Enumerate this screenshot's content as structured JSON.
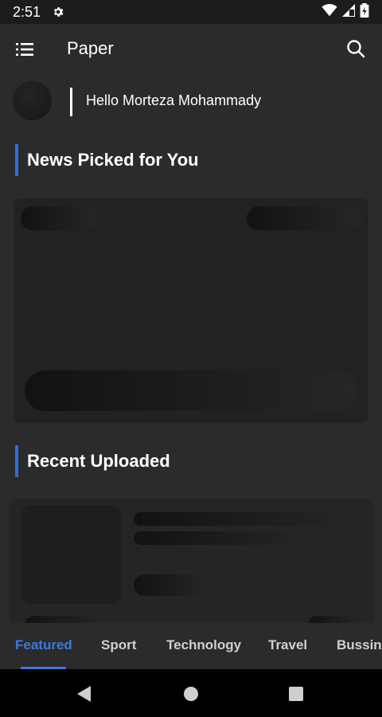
{
  "status_bar": {
    "time": "2:51",
    "icons": [
      "gear-icon",
      "wifi-icon",
      "signal-icon",
      "battery-icon"
    ]
  },
  "app_bar": {
    "title": "Paper",
    "menu_icon": "menu-icon",
    "search_icon": "search-icon"
  },
  "greeting": {
    "text": "Hello Morteza Mohammady"
  },
  "sections": {
    "news_picked": {
      "title": "News Picked for You"
    },
    "recent": {
      "title": "Recent Uploaded"
    }
  },
  "tabs": {
    "items": [
      {
        "label": "Featured",
        "active": true
      },
      {
        "label": "Sport",
        "active": false
      },
      {
        "label": "Technology",
        "active": false
      },
      {
        "label": "Travel",
        "active": false
      },
      {
        "label": "Bussine",
        "active": false
      }
    ]
  },
  "nav_bar": {
    "icons": [
      "back-icon",
      "home-icon",
      "recents-icon"
    ]
  },
  "colors": {
    "accent": "#3a7be0",
    "background": "#2b2b2b",
    "status_bar": "#1c1c1c",
    "nav_bar": "#000000"
  }
}
